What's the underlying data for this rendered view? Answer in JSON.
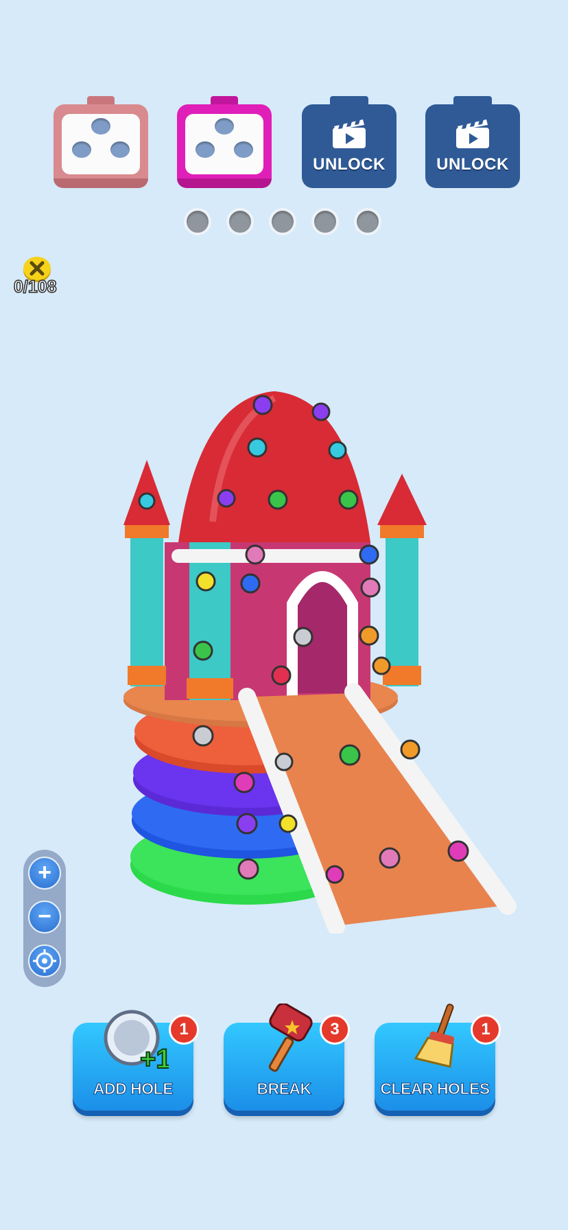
{
  "slots": [
    {
      "type": "box",
      "color": "#d98a8f"
    },
    {
      "type": "box",
      "color": "#e01fb8"
    },
    {
      "type": "locked",
      "label": "UNLOCK",
      "icon": "video-clapperboard-icon"
    },
    {
      "type": "locked",
      "label": "UNLOCK",
      "icon": "video-clapperboard-icon"
    }
  ],
  "progress_dots": 5,
  "screw_counter": {
    "icon": "screw-icon",
    "text": "0/108"
  },
  "zoom": {
    "in_icon": "plus-icon",
    "out_icon": "minus-icon",
    "recenter_icon": "target-icon"
  },
  "boosters": {
    "add_hole": {
      "label": "ADD HOLE",
      "count": "1",
      "icon": "hole-plus-one-icon",
      "icon_text": "+1"
    },
    "break": {
      "label": "BREAK",
      "count": "3",
      "icon": "hammer-icon"
    },
    "clear_holes": {
      "label": "CLEAR HOLES",
      "count": "1",
      "icon": "broom-icon"
    }
  },
  "colors": {
    "background": "#d6eaf9",
    "locked_slot": "#2f5a96",
    "booster": "#1b8fe8",
    "badge": "#e5392b"
  }
}
